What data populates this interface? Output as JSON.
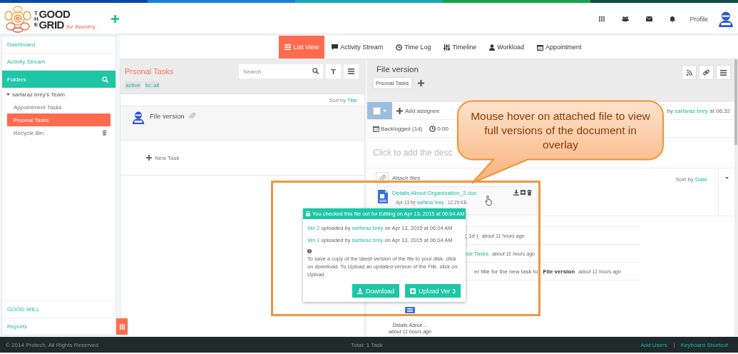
{
  "header": {
    "logo": {
      "the": "THE",
      "good": "GOOD",
      "grid": "GRID",
      "tagline": "for Reentry"
    },
    "profile_label": "Profile"
  },
  "sidebar": {
    "top_items": [
      {
        "label": "Dashboard"
      },
      {
        "label": "Activity Stream"
      }
    ],
    "folders": {
      "title": "Folders"
    },
    "team": {
      "label": "sarfaraz brey's Team",
      "expanded": true,
      "children": [
        {
          "label": "Appointment Tasks",
          "selected": false,
          "kind": "folder"
        },
        {
          "label": "Prsonal Tasks",
          "selected": true,
          "kind": "folder"
        },
        {
          "label": "Recycle Bin",
          "selected": false,
          "kind": "trash"
        }
      ]
    },
    "bottom_items": [
      {
        "label": "GOOD WILL"
      },
      {
        "label": "Reports"
      }
    ]
  },
  "view_tabs": [
    {
      "label": "List View",
      "selected": true
    },
    {
      "label": "Activity Stream",
      "selected": false
    },
    {
      "label": "Time Log",
      "selected": false
    },
    {
      "label": "Timeline",
      "selected": false
    },
    {
      "label": "Workload",
      "selected": false
    },
    {
      "label": "Appointment",
      "selected": false
    }
  ],
  "task_list": {
    "title": "Prsonal Tasks",
    "search": {
      "placeholder": "Search"
    },
    "filters": [
      "active",
      "to: all"
    ],
    "sort": {
      "label": "Sort by",
      "value": "Title"
    },
    "tasks": [
      {
        "title": "File version",
        "has_attachment": true
      }
    ],
    "new_task": "New Task"
  },
  "task_detail": {
    "title": "File version",
    "tags": [
      "Prsonal Tasks"
    ],
    "select_all": {
      "checked": false
    },
    "add_assignee": "Add assignee",
    "created_by": {
      "prefix": "by",
      "user": "sarfaraz brey",
      "suffix": "at 06:32"
    },
    "status": "Backlogged (1d)",
    "time": "0:00",
    "description_placeholder": "Click to add the desc",
    "attach_label": "Attach files",
    "sort": {
      "label": "Sort by",
      "value": "Date"
    },
    "file": {
      "name": "Details About Organization_2.doc",
      "date": "Apr 13 by",
      "user": "sarfaraz brey",
      "size": ". 12.29 KB"
    },
    "activity": [
      {
        "kind": "text",
        "text": "( 1d )",
        "time": "about 11 hours ago"
      },
      {
        "kind": "link",
        "text": "nal Tasks",
        "time": "about 11 hours ago"
      },
      {
        "kind": "text",
        "text": "er title for the new task to **File version**",
        "time": "about 11 hours ago"
      }
    ],
    "attachment_preview": {
      "name": "Details About ...",
      "time": "about 11 hours ago"
    }
  },
  "version_popup": {
    "header": "You checked this file out for Editing on Apr 13, 2015 at 06:04 AM",
    "versions": [
      {
        "version": "Ver 2",
        "uploaded_by": "uploaded by",
        "user": "sarfaraz brey",
        "date": "on Apr 13, 2015 at 06:04 AM"
      },
      {
        "version": "Ver 1",
        "uploaded_by": "uploaded by",
        "user": "sarfaraz brey",
        "date": "on Apr 13, 2015 at 06:04 AM"
      }
    ],
    "info": "To save a copy of the latest version of the file to your disk. click on download. To Upload an updated version of the File. click on Upload",
    "buttons": [
      {
        "label": "Download",
        "kind": "download"
      },
      {
        "label": "Upload Ver 3",
        "kind": "upload"
      }
    ]
  },
  "callout": {
    "text": "Mouse hover on attached file to view full versions of the document in overlay"
  },
  "footer": {
    "copyright": "© 2014 Protech, All Rights Reserved",
    "total": "Total: 1 Task",
    "links": [
      "Add Users",
      "Keyboard Shortcut"
    ]
  }
}
